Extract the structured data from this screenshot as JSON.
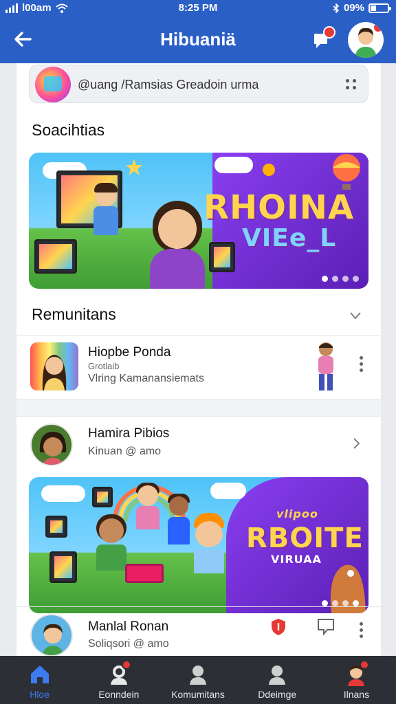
{
  "status_bar": {
    "carrier": "l00am",
    "time": "8:25 PM",
    "battery": "09%"
  },
  "header": {
    "title": "Hibuaniä"
  },
  "search": {
    "text": "@uang /Ramsias Greadoin urma"
  },
  "sections": {
    "first": "Soacihtias",
    "second": "Remunitans"
  },
  "banners": [
    {
      "brand_line1": "RHOINA",
      "brand_line2": "VIEe_L"
    },
    {
      "brand_small": "vlipoo",
      "brand_line1": "RBOITE",
      "brand_line2": "VIRUAA"
    }
  ],
  "rows": [
    {
      "name": "Hiopbe Ponda",
      "meta": "Grotlaib",
      "sub": "Vlring Kamanansiemats"
    },
    {
      "name": "Hamira Pibios",
      "sub": "Kinuan @ amo"
    },
    {
      "name": "Manlal Ronan",
      "sub": "Soliqsori @ amo"
    }
  ],
  "bottom_nav": [
    {
      "label": "Hloe",
      "icon": "home-icon",
      "active": true
    },
    {
      "label": "Eonndein",
      "icon": "community-icon",
      "active": false
    },
    {
      "label": "Komumitans",
      "icon": "person-icon",
      "active": false
    },
    {
      "label": "Ddeimge",
      "icon": "profile-icon",
      "active": false
    },
    {
      "label": "Ilnans",
      "icon": "account-icon",
      "active": false
    }
  ],
  "colors": {
    "primary": "#2a5fc6",
    "nav_bg": "#2c2f35",
    "active": "#3d7bf0",
    "badge": "#e53935"
  }
}
